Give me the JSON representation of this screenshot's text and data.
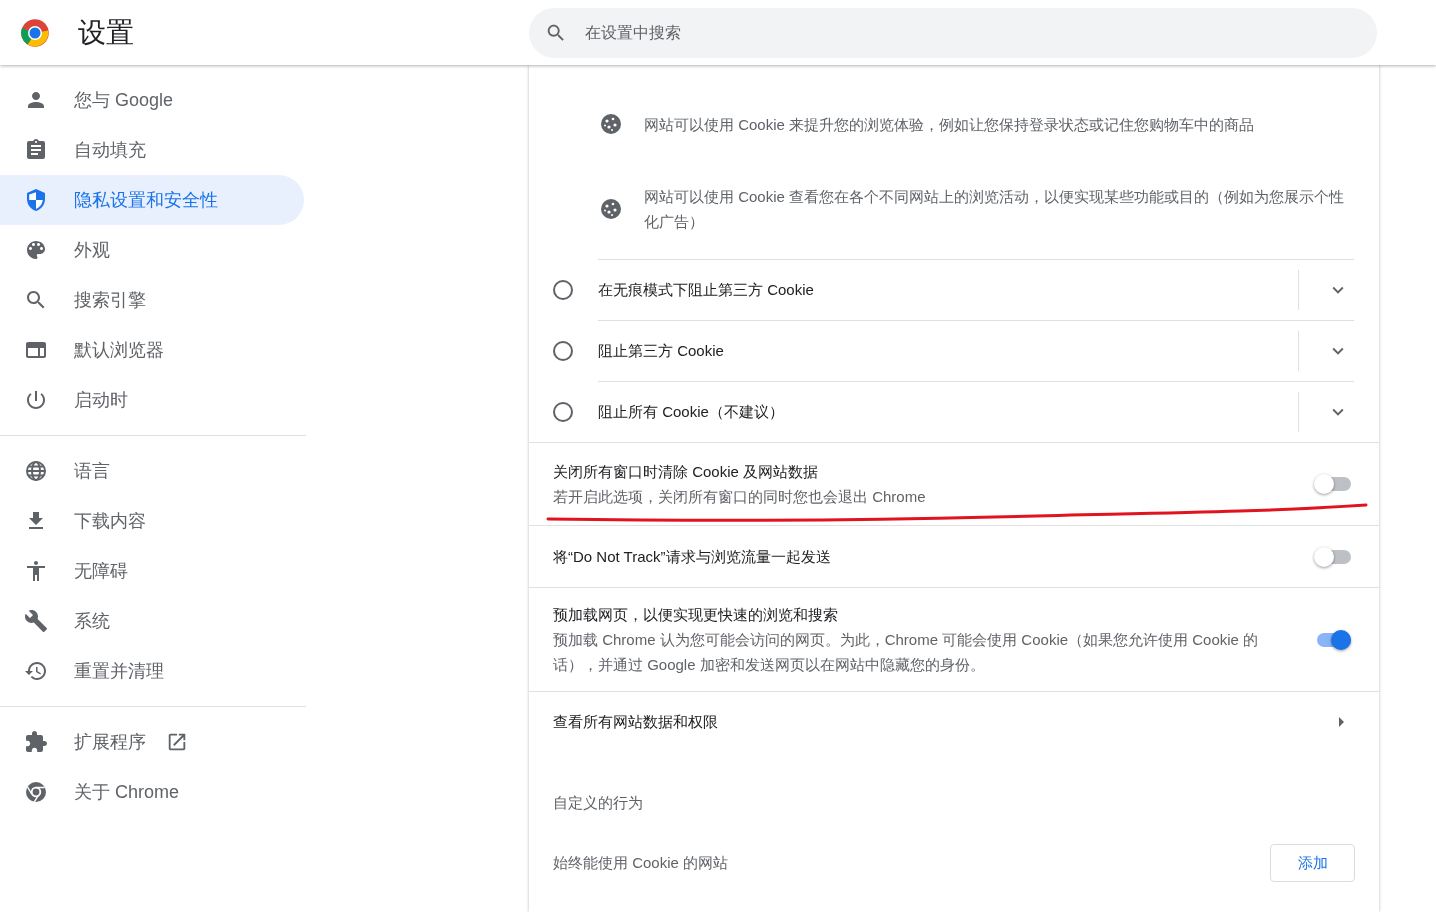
{
  "header": {
    "title": "设置",
    "search": {
      "placeholder": "在设置中搜索"
    }
  },
  "sidebar": {
    "groups": [
      [
        {
          "label": "您与 Google",
          "selected": false
        },
        {
          "label": "自动填充",
          "selected": false
        },
        {
          "label": "隐私设置和安全性",
          "selected": true
        },
        {
          "label": "外观",
          "selected": false
        },
        {
          "label": "搜索引擎",
          "selected": false
        },
        {
          "label": "默认浏览器",
          "selected": false
        },
        {
          "label": "启动时",
          "selected": false
        }
      ],
      [
        {
          "label": "语言",
          "selected": false
        },
        {
          "label": "下载内容",
          "selected": false
        },
        {
          "label": "无障碍",
          "selected": false
        },
        {
          "label": "系统",
          "selected": false
        },
        {
          "label": "重置并清理",
          "selected": false
        }
      ],
      [
        {
          "label": "扩展程序",
          "selected": false
        },
        {
          "label": "关于 Chrome",
          "selected": false
        }
      ]
    ]
  },
  "main": {
    "info_rows": [
      {
        "text": "网站可以使用 Cookie 来提升您的浏览体验，例如让您保持登录状态或记住您购物车中的商品"
      },
      {
        "text": "网站可以使用 Cookie 查看您在各个不同网站上的浏览活动，以便实现某些功能或目的（例如为您展示个性化广告）"
      }
    ],
    "radio_options": [
      {
        "label": "在无痕模式下阻止第三方 Cookie",
        "selected": false
      },
      {
        "label": "阻止第三方 Cookie",
        "selected": false
      },
      {
        "label": "阻止所有 Cookie（不建议）",
        "selected": false
      }
    ],
    "toggles": [
      {
        "title": "关闭所有窗口时清除 Cookie 及网站数据",
        "description": "若开启此选项，关闭所有窗口的同时您也会退出 Chrome",
        "on": false
      },
      {
        "title": "将“Do Not Track”请求与浏览流量一起发送",
        "on": false
      },
      {
        "title": "预加载网页，以便实现更快速的浏览和搜索",
        "description": "预加载 Chrome 认为您可能会访问的网页。为此，Chrome 可能会使用 Cookie（如果您允许使用 Cookie 的话），并通过 Google 加密和发送网页以在网站中隐藏您的身份。",
        "on": true
      }
    ],
    "link_row": {
      "label": "查看所有网站数据和权限"
    },
    "custom_section": {
      "heading": "自定义的行为",
      "rows": [
        {
          "label": "始终能使用 Cookie 的网站",
          "button": "添加"
        }
      ]
    }
  }
}
